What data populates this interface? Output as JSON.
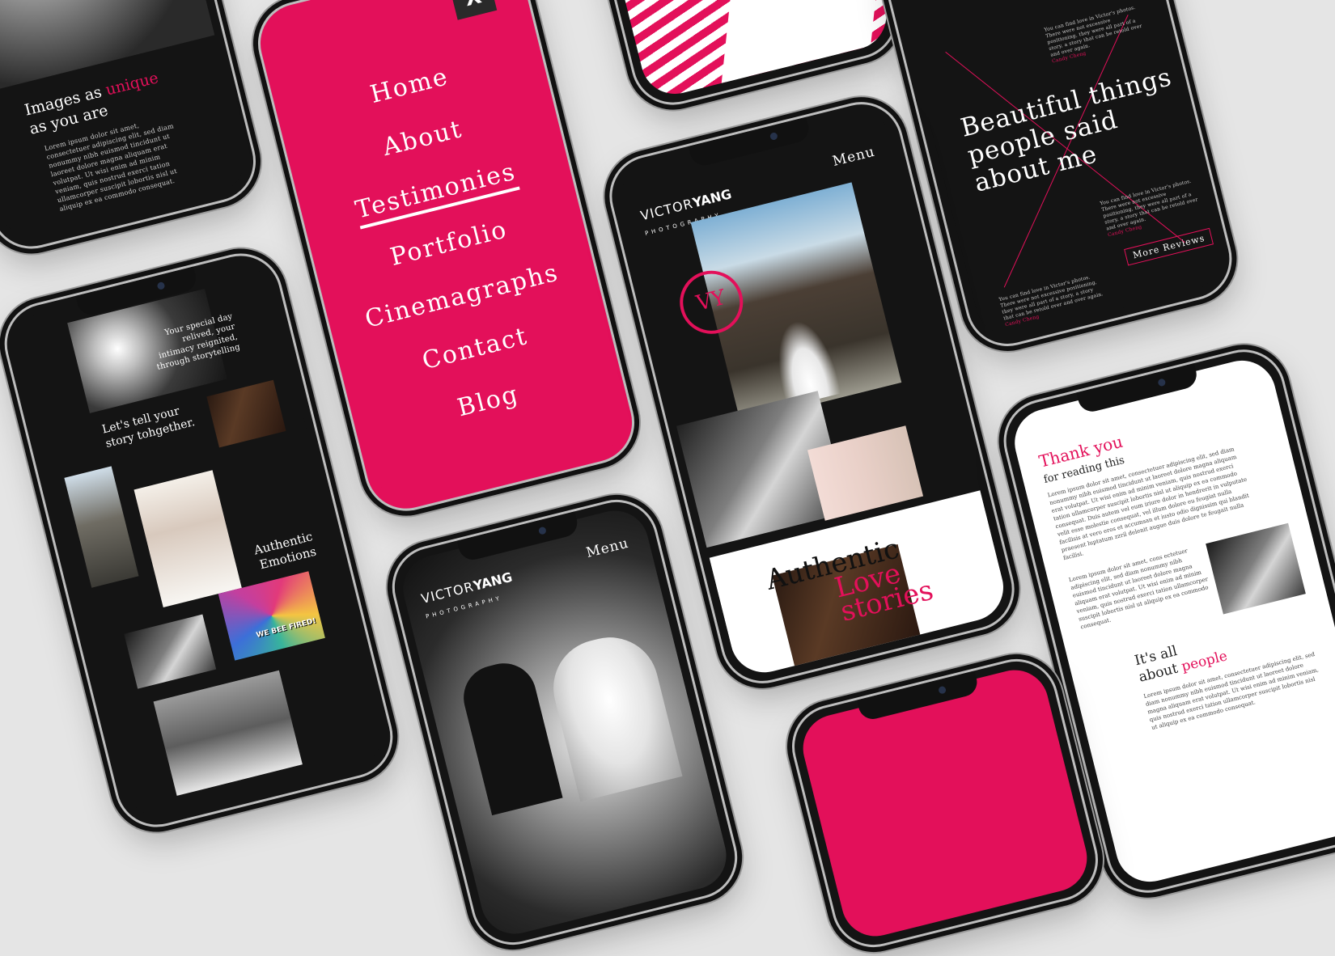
{
  "colors": {
    "accent": "#e3105a",
    "dark": "#141414",
    "background": "#e5e5e5"
  },
  "phone_a": {
    "heading_start": "Images as",
    "heading_accent": "unique",
    "heading_end": "as you are",
    "body": "Lorem ipsum dolor sit amet, consectetuer adipiscing elit, sed diam nonummy nibh euismod tincidunt ut laoreet dolore magna aliquam erat volutpat. Ut wisi enim ad minim veniam, quis nostrud exerci tation ullamcorper suscipit lobortis nisl ut aliquip ex ea commodo consequat."
  },
  "menu_phone": {
    "close_label": "X",
    "items": [
      "Home",
      "About",
      "Testimonies",
      "Portfolio",
      "Cinemagraphs",
      "Contact",
      "Blog"
    ],
    "active_index": 2
  },
  "home_phone": {
    "logo_first": "VICTOR",
    "logo_last": "YANG",
    "logo_sub": "PHOTOGRAPHY",
    "menu_label": "Menu",
    "monogram": "VY",
    "heading_line1": "Authentic",
    "heading_accent1": "Love",
    "heading_accent2": "stories"
  },
  "testimonials_phone": {
    "heading": "Beautiful things people said about me",
    "quote": "You can find love in Victor's photos. There were not excessive positioning, they were all part of a story, a story that can be retold over and over again.",
    "author": "Candy Cheng",
    "more_button": "More Reviews"
  },
  "story_phone": {
    "caption1": "Your special day relived, your intimacy reignited, through storytelling",
    "heading1": "Let's tell your story tohgether.",
    "heading2": "Authentic Emotions",
    "graffiti_text": "WE BEE FIRED!"
  },
  "bw_phone": {
    "logo_first": "VICTOR",
    "logo_last": "YANG",
    "logo_sub": "PHOTOGRAPHY",
    "menu_label": "Menu"
  },
  "thanks_phone": {
    "heading_accent": "Thank you",
    "heading_rest": "for reading this",
    "body1": "Lorem ipsum dolor sit amet, consectetuer adipiscing elit, sed diam nonummy nibh euismod tincidunt ut laoreet dolore magna aliquam erat volutpat. Ut wisi enim ad minim veniam, quis nostrud exerci tation ullamcorper suscipit lobortis nisl ut aliquip ex ea commodo consequat. Duis autem vel eum iriure dolor in hendrerit in vulputate velit esse molestie consequat, vel illum dolore eu feugiat nulla facilisis at vero eros et accumsan et iusto odio dignissim qui blandit praesent luptatum zzril delenit augue duis dolore te feugait nulla facilisi.",
    "body2": "Lorem ipsum dolor sit amet, cons ectetuer adipiscing elit, sed diam nonummy nibh euismod tincidunt ut laoreet dolore magna aliquam erat volutpat. Ut wisi enim ad minim veniam, quis nostrud exerci tation ullamcorper suscipit lobortis nisl ut aliquip ex ea commodo consequat.",
    "heading2_start": "It's all",
    "heading2_mid": "about",
    "heading2_accent": "people",
    "body3": "Lorem ipsum dolor sit amet, consectetuer adipiscing elit, sed diam nonummy nibh euismod tincidunt ut laoreet dolore magna aliquam erat volutpat. Ut wisi enim ad minim veniam, quis nostrud exerci tation ullamcorper suscipit lobortis nisl ut aliquip ex ea commodo consequat."
  }
}
